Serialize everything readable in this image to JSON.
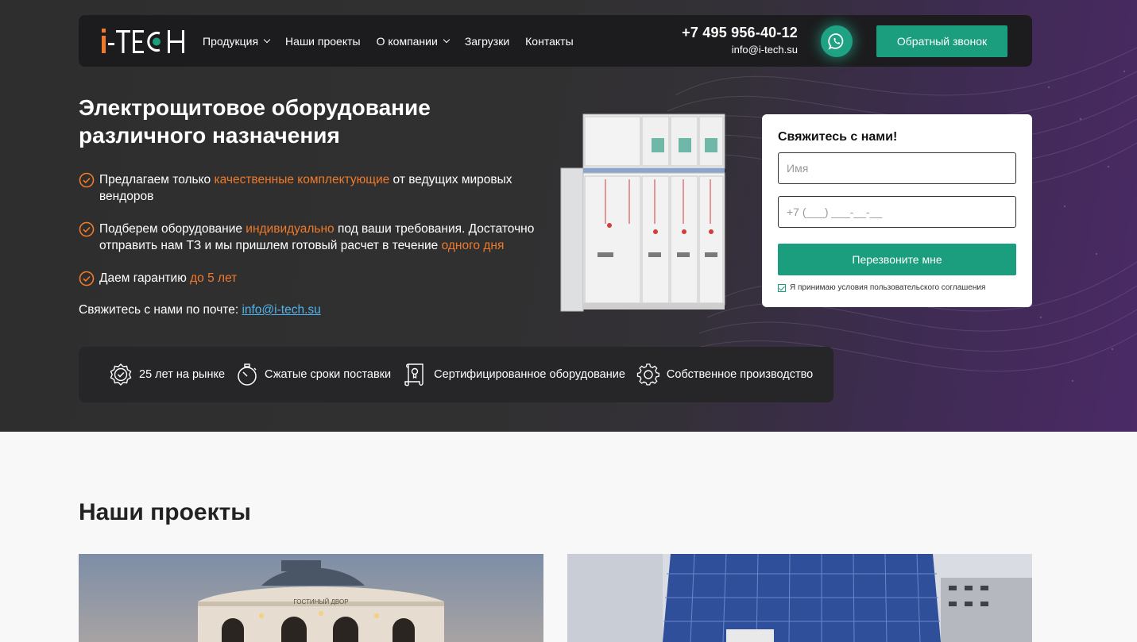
{
  "brand": {
    "logo_text": "i-TECH",
    "colors": {
      "accent": "#1a9e7e",
      "orange": "#ef7a2b",
      "link": "#4fb4ee",
      "dark": "#1c1c1e"
    }
  },
  "nav": {
    "items": [
      {
        "label": "Продукция",
        "dropdown": true
      },
      {
        "label": "Наши проекты",
        "dropdown": false
      },
      {
        "label": "О компании",
        "dropdown": true
      },
      {
        "label": "Загрузки",
        "dropdown": false
      },
      {
        "label": "Контакты",
        "dropdown": false
      }
    ],
    "phone": "+7 495 956-40-12",
    "email": "info@i-tech.su",
    "whatsapp_icon": "whatsapp-icon",
    "callback_label": "Обратный звонок"
  },
  "hero": {
    "title_line1": "Электрощитовое оборудование",
    "title_line2": "различного назначения",
    "bullets": [
      {
        "before": "Предлагаем только ",
        "highlight": "качественные комплектующие",
        "after": " от ведущих мировых вендоров"
      },
      {
        "before": "Подберем оборудование ",
        "highlight": "индивидуально",
        "after": " под ваши требования. Достаточно отправить нам ТЗ и мы пришлем готовый расчет в течение ",
        "highlight2": "одного дня"
      },
      {
        "before": "Даем гарантию ",
        "highlight": "до 5 лет",
        "after": ""
      }
    ],
    "mail_text": "Свяжитесь с нами по почте: ",
    "mail_link": "info@i-tech.su"
  },
  "form": {
    "title": "Свяжитесь с нами!",
    "name_placeholder": "Имя",
    "phone_placeholder": "+7 (___) ___-__-__",
    "submit_label": "Перезвоните мне",
    "agree_label": "Я принимаю условия пользовательского соглашения",
    "agree_checked": true
  },
  "features": [
    {
      "icon": "badge-check-icon",
      "label": "25 лет на рынке"
    },
    {
      "icon": "stopwatch-icon",
      "label": "Сжатые сроки поставки"
    },
    {
      "icon": "certificate-icon",
      "label": "Сертифицированное оборудование"
    },
    {
      "icon": "gear-icon",
      "label": "Собственное производство"
    }
  ],
  "projects": {
    "title": "Наши проекты",
    "card1_sign": "ГОСТИНЫЙ ДВОР"
  }
}
